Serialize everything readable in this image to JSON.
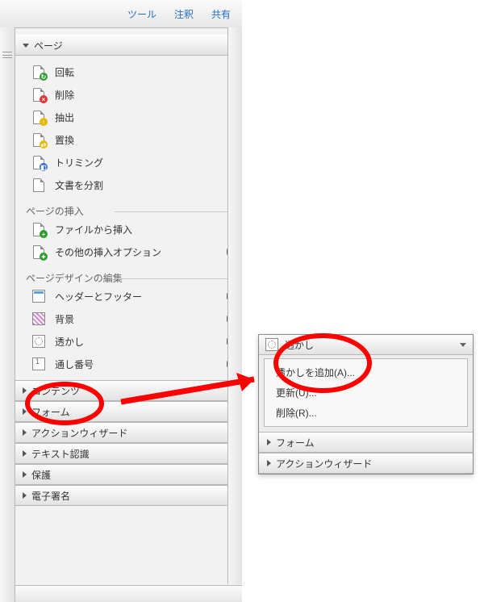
{
  "tabs": {
    "tools": "ツール",
    "comments": "注釈",
    "share": "共有"
  },
  "sections": {
    "pages": {
      "title": "ページ",
      "items": {
        "rotate": "回転",
        "delete": "削除",
        "extract": "抽出",
        "replace": "置換",
        "trimming": "トリミング",
        "split": "文書を分割"
      },
      "insert": {
        "label": "ページの挿入",
        "from_file": "ファイルから挿入",
        "more_options": "その他の挿入オプション"
      },
      "design": {
        "label": "ページデザインの編集",
        "header_footer": "ヘッダーとフッター",
        "background": "背景",
        "watermark": "透かし",
        "page_numbers": "通し番号"
      }
    },
    "collapsed": {
      "contents": "コンテンツ",
      "forms": "フォーム",
      "action_wizard": "アクションウィザード",
      "text_recognition": "テキスト認識",
      "protection": "保護",
      "esignature": "電子署名"
    }
  },
  "popup": {
    "header": "透かし",
    "items": {
      "add": "透かしを追加(A)...",
      "update": "更新(U)...",
      "delete": "削除(R)..."
    },
    "collapsed": {
      "forms": "フォーム",
      "action_wizard": "アクションウィザード"
    }
  }
}
